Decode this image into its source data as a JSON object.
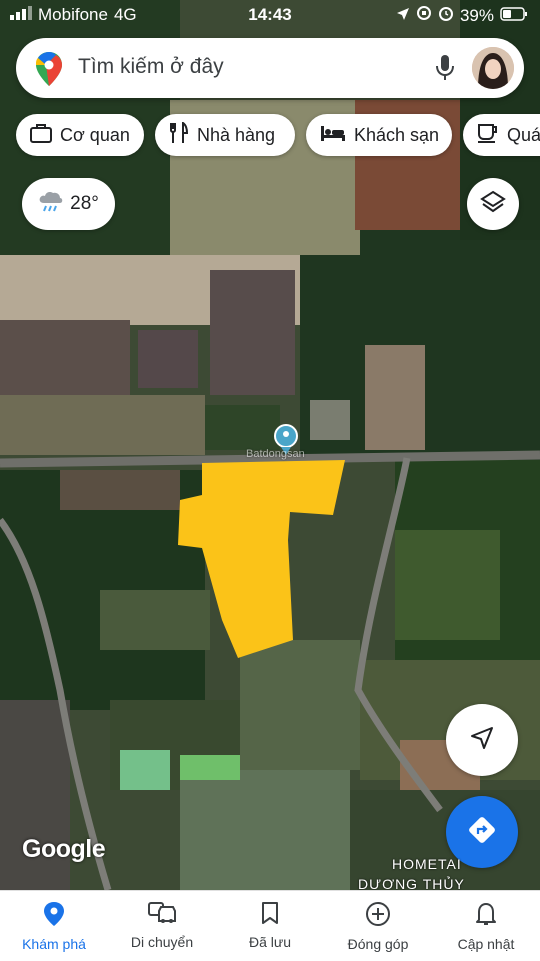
{
  "status_bar": {
    "carrier": "Mobifone",
    "network": "4G",
    "time": "14:43",
    "battery": "39%"
  },
  "search": {
    "placeholder": "Tìm kiếm ở đây"
  },
  "chips": [
    {
      "label": "Cơ quan",
      "icon": "briefcase-icon"
    },
    {
      "label": "Nhà hàng",
      "icon": "fork-knife-icon"
    },
    {
      "label": "Khách sạn",
      "icon": "bed-icon"
    },
    {
      "label": "Quá",
      "icon": "cup-icon"
    }
  ],
  "weather": {
    "temperature": "28°",
    "icon": "rain-cloud-icon"
  },
  "map": {
    "attribution": "Google",
    "place_label_1": "HOMETAI",
    "place_label_2": "DƯƠNG THỦY",
    "watermark": "Batdongsan",
    "highlight_color": "#fbc318",
    "pin_color": "#4aa5c9"
  },
  "bottom_nav": [
    {
      "label": "Khám phá",
      "icon": "location-pin-icon",
      "active": true
    },
    {
      "label": "Di chuyển",
      "icon": "car-icon",
      "active": false
    },
    {
      "label": "Đã lưu",
      "icon": "bookmark-icon",
      "active": false
    },
    {
      "label": "Đóng góp",
      "icon": "plus-circle-icon",
      "active": false
    },
    {
      "label": "Cập nhật",
      "icon": "bell-icon",
      "active": false
    }
  ],
  "colors": {
    "accent": "#1a73e8",
    "directions_fab": "#1a73e8"
  }
}
